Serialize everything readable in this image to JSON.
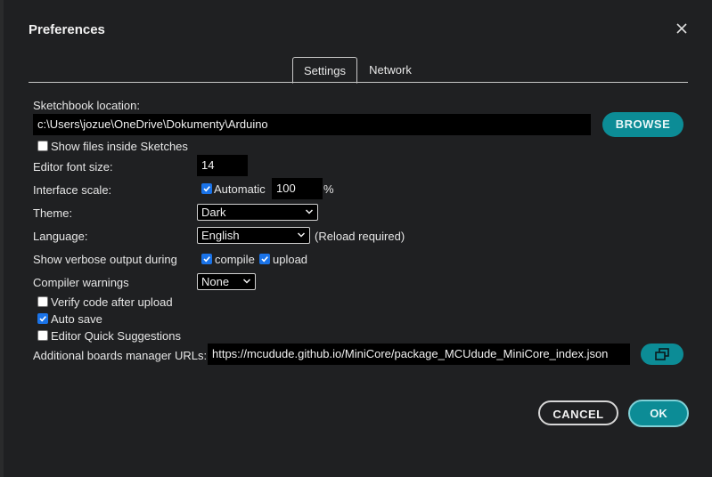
{
  "dialog": {
    "title": "Preferences",
    "tabs": [
      {
        "label": "Settings",
        "active": true
      },
      {
        "label": "Network",
        "active": false
      }
    ]
  },
  "settings": {
    "sketchbook_label": "Sketchbook location:",
    "sketchbook_path": "c:\\Users\\jozue\\OneDrive\\Dokumenty\\Arduino",
    "browse_label": "BROWSE",
    "show_files_label": "Show files inside Sketches",
    "show_files_checked": false,
    "font_size_label": "Editor font size:",
    "font_size_value": "14",
    "scale_label": "Interface scale:",
    "scale_automatic_label": "Automatic",
    "scale_automatic_checked": true,
    "scale_value": "100",
    "scale_unit": "%",
    "theme_label": "Theme:",
    "theme_value": "Dark",
    "language_label": "Language:",
    "language_value": "English",
    "language_note": "(Reload required)",
    "verbose_label": "Show verbose output during",
    "verbose_compile_label": "compile",
    "verbose_compile_checked": true,
    "verbose_upload_label": "upload",
    "verbose_upload_checked": true,
    "warnings_label": "Compiler warnings",
    "warnings_value": "None",
    "verify_label": "Verify code after upload",
    "verify_checked": false,
    "autosave_label": "Auto save",
    "autosave_checked": true,
    "quick_suggest_label": "Editor Quick Suggestions",
    "quick_suggest_checked": false,
    "boards_urls_label": "Additional boards manager URLs:",
    "boards_urls_value": "https://mcudude.github.io/MiniCore/package_MCUdude_MiniCore_index.json"
  },
  "footer": {
    "cancel_label": "CANCEL",
    "ok_label": "OK"
  },
  "colors": {
    "accent": "#0c8c96",
    "checkbox": "#1a73e8",
    "background": "#1f2022"
  },
  "icons": {
    "close": "close-icon",
    "dropdown": "chevron-down-icon",
    "url_editor": "open-window-icon",
    "check": "check-icon"
  }
}
